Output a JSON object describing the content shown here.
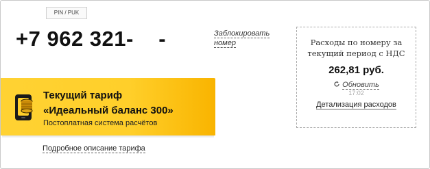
{
  "pin_tab": {
    "label": "PIN / PUK"
  },
  "phone": {
    "number": "+7 962 321-    -"
  },
  "block_link": {
    "line1": "Заблокировать",
    "line2": "номер"
  },
  "expenses": {
    "caption_line1": "Расходы по номеру за",
    "caption_line2": "текущий период с НДС",
    "amount": "262,81 руб.",
    "refresh_label": "Обновить",
    "refresh_icon": "refresh-icon",
    "time": "17:02",
    "detail_link": "Детализация расходов"
  },
  "tariff": {
    "icon": "coins-phone-icon",
    "title_line1": "Текущий тариф",
    "title_line2": "«Идеальный баланс 300»",
    "subtitle": "Постоплатная система расчётов",
    "accent": "#ffd233"
  },
  "tariff_link": {
    "label": "Подробное описание тарифа"
  }
}
